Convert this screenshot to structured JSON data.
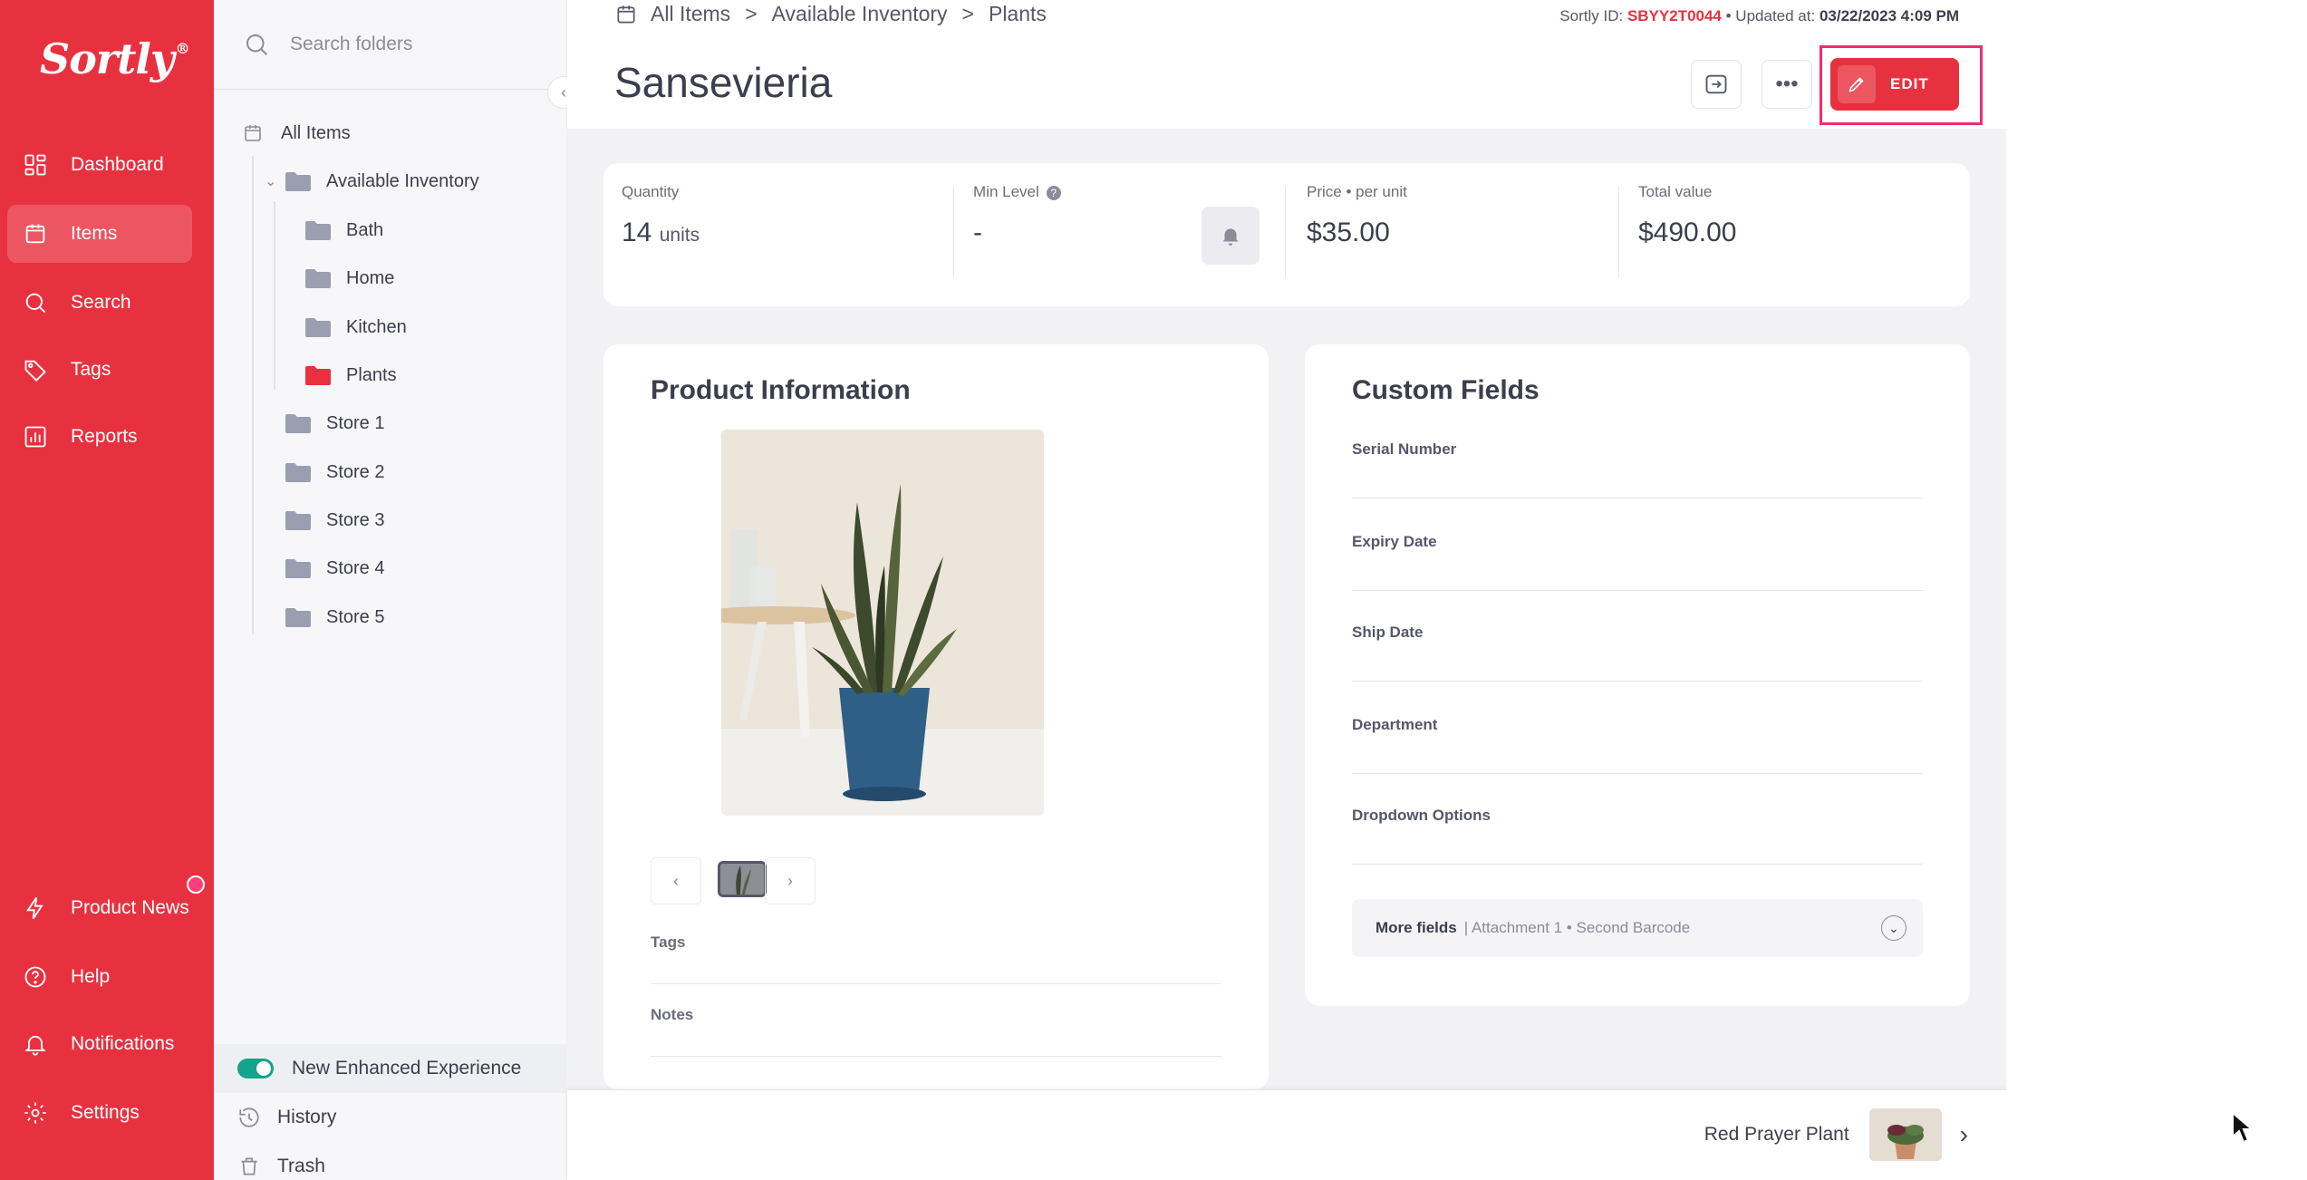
{
  "nav": {
    "logo": "Sortly",
    "logo_mark": "®",
    "items": [
      {
        "label": "Dashboard",
        "icon": "dashboard-icon"
      },
      {
        "label": "Items",
        "icon": "items-icon",
        "active": true
      },
      {
        "label": "Search",
        "icon": "search-icon"
      },
      {
        "label": "Tags",
        "icon": "tag-icon"
      },
      {
        "label": "Reports",
        "icon": "reports-icon"
      }
    ],
    "bottom_items": [
      {
        "label": "Product News",
        "icon": "bolt-icon"
      },
      {
        "label": "Help",
        "icon": "help-icon"
      },
      {
        "label": "Notifications",
        "icon": "bell-icon"
      },
      {
        "label": "Settings",
        "icon": "gear-icon"
      }
    ],
    "accent": "#e8313f"
  },
  "folders": {
    "search_placeholder": "Search folders",
    "all_items": "All Items",
    "tree": {
      "root": "Available Inventory",
      "children": [
        "Bath",
        "Home",
        "Kitchen",
        "Plants"
      ],
      "siblings": [
        "Store 1",
        "Store 2",
        "Store 3",
        "Store 4",
        "Store 5"
      ],
      "selected": "Plants"
    },
    "bottom": {
      "enhanced": "New Enhanced Experience",
      "history": "History",
      "trash": "Trash"
    }
  },
  "header": {
    "breadcrumb": [
      "All Items",
      "Available Inventory",
      "Plants"
    ],
    "sortly_id_label": "Sortly ID:",
    "sortly_id": "SBYY2T0044",
    "updated_label": "• Updated at:",
    "updated_at": "03/22/2023 4:09 PM",
    "title": "Sansevieria",
    "edit_label": "EDIT"
  },
  "stats": {
    "quantity_label": "Quantity",
    "quantity_value": "14",
    "quantity_unit": "units",
    "min_level_label": "Min Level",
    "min_level_value": "-",
    "price_label": "Price • per unit",
    "price_value": "$35.00",
    "total_label": "Total value",
    "total_value": "$490.00"
  },
  "product": {
    "title": "Product Information",
    "tags_label": "Tags",
    "notes_label": "Notes"
  },
  "custom": {
    "title": "Custom Fields",
    "fields": [
      "Serial Number",
      "Expiry Date",
      "Ship Date",
      "Department",
      "Dropdown Options"
    ],
    "more_label": "More fields",
    "more_detail": "| Attachment 1 • Second Barcode"
  },
  "footer": {
    "next_item": "Red Prayer Plant"
  }
}
